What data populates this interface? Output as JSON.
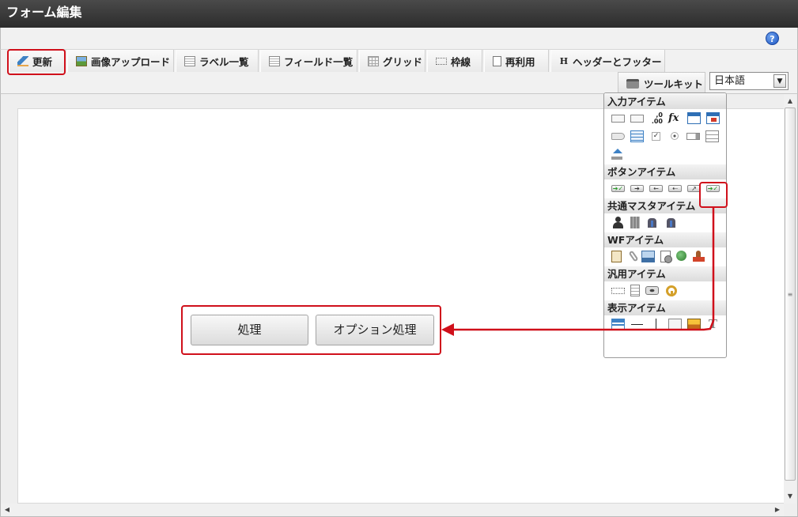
{
  "title": "フォーム編集",
  "help_icon": "help-icon",
  "toolbar": {
    "buttons": [
      {
        "label": "更新",
        "icon": "update-icon"
      },
      {
        "label": "画像アップロード",
        "icon": "image-upload-icon"
      },
      {
        "label": "ラベル一覧",
        "icon": "list-icon"
      },
      {
        "label": "フィールド一覧",
        "icon": "list-icon"
      },
      {
        "label": "グリッド",
        "icon": "grid-icon"
      },
      {
        "label": "枠線",
        "icon": "frame-icon"
      },
      {
        "label": "再利用",
        "icon": "document-icon"
      },
      {
        "label": "ヘッダーとフッター",
        "icon": "header-icon",
        "icon_text": "H"
      }
    ],
    "toolkit_label": "ツールキット",
    "language": "日本語"
  },
  "palette": {
    "sections": [
      {
        "title": "入力アイテム"
      },
      {
        "title": "ボタンアイテム"
      },
      {
        "title": "共通マスタアイテム"
      },
      {
        "title": "WFアイテム"
      },
      {
        "title": "汎用アイテム"
      },
      {
        "title": "表示アイテム"
      }
    ],
    "number_glyph": ",0\n.00",
    "fx_glyph": "fx"
  },
  "canvas": {
    "buttons": [
      {
        "label": "処理"
      },
      {
        "label": "オプション処理"
      }
    ]
  },
  "colors": {
    "highlight": "#d0101b",
    "titlebar": "#333333"
  }
}
